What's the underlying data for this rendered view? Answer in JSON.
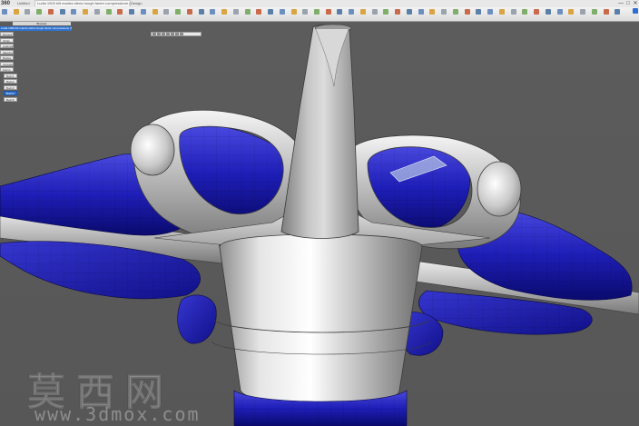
{
  "app": {
    "logo": "360",
    "tabs": [
      "Untitled",
      "Ludla 1000 bilt mantra sferia hough fanter compressione (NT) 1",
      "Design"
    ],
    "window_controls": [
      "—",
      "□",
      "✕"
    ],
    "user_icon": "user-icon"
  },
  "ribbon": {
    "accent": "#2d6fd1",
    "button_icons": [
      "new-icon",
      "save-icon",
      "undo-icon",
      "redo-icon",
      "sketch-icon",
      "extrude-icon",
      "revolve-icon",
      "sweep-icon",
      "loft-icon",
      "fillet-icon",
      "chamfer-icon",
      "shell-icon",
      "mirror-icon",
      "pattern-icon",
      "move-icon",
      "align-icon",
      "split-icon",
      "combine-icon",
      "form-icon",
      "box-icon",
      "plane-icon",
      "cylinder-icon",
      "sphere-icon",
      "torus-icon",
      "quadball-icon",
      "pipe-icon",
      "face-icon",
      "edit-form-icon",
      "insert-edge-icon",
      "subdivide-icon",
      "bridge-icon",
      "fill-hole-icon",
      "weld-icon",
      "unweld-icon",
      "crease-icon",
      "uncrease-icon",
      "bevel-icon",
      "smooth-icon",
      "pull-icon",
      "flatten-icon",
      "match-icon",
      "interpolate-icon",
      "thicken-icon",
      "freeze-icon",
      "measure-icon",
      "inspect-icon",
      "zebra-icon",
      "curvature-icon",
      "insert-icon",
      "canvas-icon",
      "decal-icon",
      "select-icon",
      "window-select-icon",
      "finish-icon"
    ]
  },
  "browser": {
    "header": "Browser",
    "document_name": "Ludla 1000 bilt mantra sferia hough fanter compressione (NT) 1",
    "nodes": [
      {
        "label": "Named Views",
        "selected": false
      },
      {
        "label": "Origin",
        "selected": false
      },
      {
        "label": "Analysis",
        "selected": false
      },
      {
        "label": "Sketches",
        "selected": false
      },
      {
        "label": "Bodies",
        "selected": false
      },
      {
        "label": "Canvases",
        "selected": false
      },
      {
        "label": "Forms",
        "selected": false
      },
      {
        "label": "Body1",
        "selected": false
      },
      {
        "label": "Body2",
        "selected": false
      },
      {
        "label": "Body3",
        "selected": false
      },
      {
        "label": "Body4",
        "selected": true
      },
      {
        "label": "Body5",
        "selected": false
      }
    ]
  },
  "viewbar": {
    "icons": [
      "orbit-icon",
      "pan-icon",
      "zoom-icon",
      "fit-icon",
      "display-icon",
      "grid-icon",
      "view-icon"
    ]
  },
  "watermark": {
    "chinese": "莫西网",
    "url": "www.3dmox.com"
  }
}
